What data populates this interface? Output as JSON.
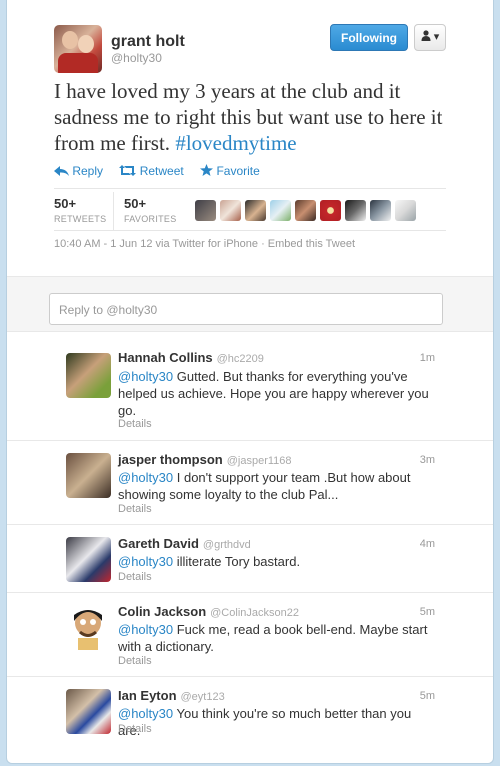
{
  "tweet": {
    "name": "grant holt",
    "handle": "@holty30",
    "follow_label": "Following",
    "user_menu_icon": "person-icon",
    "text": "I have loved my 3 years at the club and it sadness me to right this but want use to here it from me first. ",
    "hashtag": "#lovedmytime",
    "actions": [
      {
        "icon": "reply-arrow-icon",
        "label": "Reply"
      },
      {
        "icon": "retweet-icon",
        "label": "Retweet"
      },
      {
        "icon": "star-icon",
        "label": "Favorite"
      }
    ],
    "retweets": {
      "count": "50+",
      "label": "RETWEETS"
    },
    "favorites": {
      "count": "50+",
      "label": "FAVORITES"
    },
    "meta": "10:40 AM - 1 Jun 12 via Twitter for iPhone · Embed this Tweet"
  },
  "reply_box": {
    "placeholder": "Reply to @holty30"
  },
  "replies": [
    {
      "name": "Hannah Collins",
      "handle": "@hc2209",
      "time": "1m",
      "mention": "@holty30",
      "text": " Gutted. But thanks for everything you've helped us achieve. Hope you are happy wherever you go.",
      "details": "Details"
    },
    {
      "name": "jasper thompson",
      "handle": "@jasper1168",
      "time": "3m",
      "mention": "@holty30",
      "text": " I don't support your team .But how about showing some loyalty to the club Pal...",
      "details": "Details"
    },
    {
      "name": "Gareth David",
      "handle": "@grthdvd",
      "time": "4m",
      "mention": "@holty30",
      "text": " illiterate Tory bastard.",
      "details": "Details"
    },
    {
      "name": "Colin Jackson",
      "handle": "@ColinJackson22",
      "time": "5m",
      "mention": "@holty30",
      "text": " Fuck me, read a book bell-end. Maybe start with a dictionary.",
      "details": "Details"
    },
    {
      "name": "Ian Eyton",
      "handle": "@eyt123",
      "time": "5m",
      "mention": "@holty30",
      "text": " You think you're so much better than you are.",
      "details": "Details"
    }
  ],
  "colors": {
    "accent": "#2a86c6",
    "follow_button": "#2a8bd1",
    "background": "#c9dfef"
  }
}
